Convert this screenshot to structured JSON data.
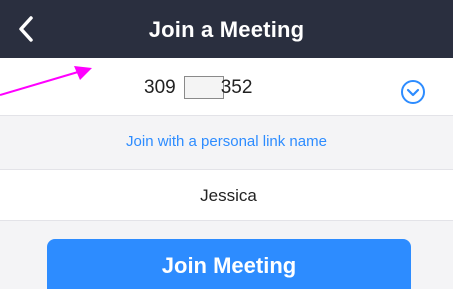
{
  "header": {
    "title": "Join a Meeting",
    "back_icon": "chevron-left-icon"
  },
  "meeting_id": {
    "prefix": "309",
    "suffix": "352",
    "redacted": true,
    "dropdown_icon": "chevron-down-circle-icon"
  },
  "personal_link": {
    "label": "Join with a personal link name"
  },
  "name_field": {
    "value": "Jessica"
  },
  "join_button": {
    "label": "Join Meeting"
  },
  "colors": {
    "header_bg": "#2a2f3f",
    "accent_blue": "#2d8cff",
    "annotation_arrow": "#ff00ff",
    "light_gray_bg": "#f4f4f6"
  }
}
